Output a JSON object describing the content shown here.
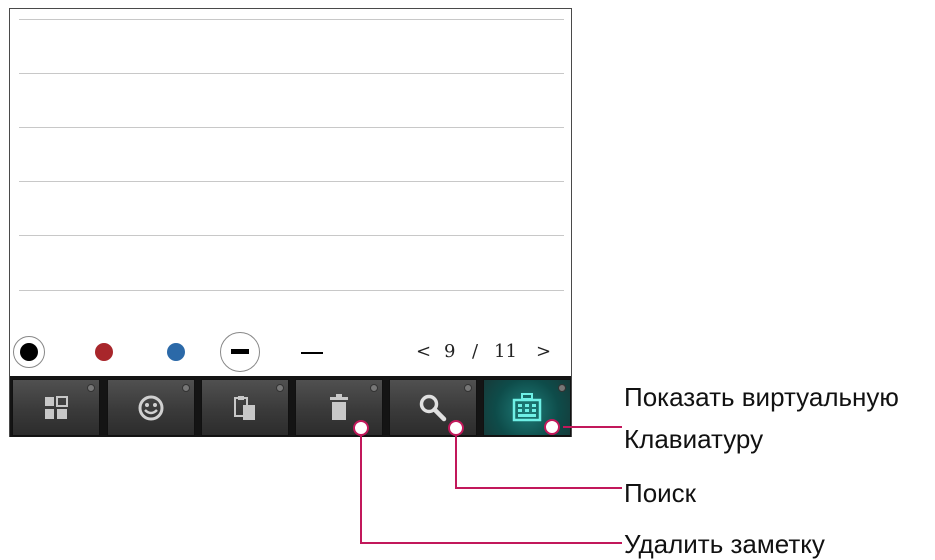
{
  "pen_palette": {
    "colors": [
      {
        "name": "black",
        "hex": "#000000"
      },
      {
        "name": "red",
        "hex": "#a8262b"
      },
      {
        "name": "blue",
        "hex": "#2b69a8"
      }
    ],
    "stroke_options": [
      "thick-stroke-icon",
      "thin-stroke-icon"
    ]
  },
  "pager": {
    "prev": "<",
    "current": "9",
    "separator": "/",
    "total": "11",
    "next": ">"
  },
  "toolbar": {
    "buttons": [
      {
        "icon": "grid-icon"
      },
      {
        "icon": "smiley-icon"
      },
      {
        "icon": "paste-icon"
      },
      {
        "icon": "trash-icon"
      },
      {
        "icon": "search-icon"
      },
      {
        "icon": "keyboard-icon",
        "active": true
      }
    ],
    "accent": "#1f7e7a"
  },
  "callouts": {
    "keyboard_line1": "Показать виртуальную",
    "keyboard_line2": "Клавиатуру",
    "search": "Поиск",
    "delete": "Удалить заметку",
    "leader_color": "#c2185b"
  }
}
